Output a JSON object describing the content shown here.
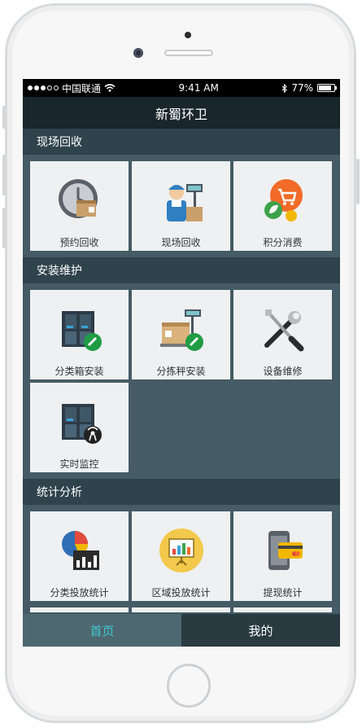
{
  "status_bar": {
    "carrier": "中国联通",
    "time": "9:41 AM",
    "battery": "77%"
  },
  "app": {
    "title": "新蜀环卫"
  },
  "sections": [
    {
      "title": "现场回收",
      "tiles": [
        {
          "label": "预约回收",
          "icon": "clock-box-icon"
        },
        {
          "label": "现场回收",
          "icon": "worker-icon"
        },
        {
          "label": "积分消费",
          "icon": "cart-icon"
        }
      ]
    },
    {
      "title": "安装维护",
      "tiles": [
        {
          "label": "分类箱安装",
          "icon": "bin-install-icon"
        },
        {
          "label": "分拣秤安装",
          "icon": "scale-install-icon"
        },
        {
          "label": "设备维修",
          "icon": "tools-icon"
        },
        {
          "label": "实时监控",
          "icon": "monitor-icon"
        }
      ]
    },
    {
      "title": "统计分析",
      "tiles": [
        {
          "label": "分类投放统计",
          "icon": "pie-chart-icon"
        },
        {
          "label": "区域投放统计",
          "icon": "presentation-icon"
        },
        {
          "label": "提现统计",
          "icon": "phone-card-icon"
        }
      ]
    }
  ],
  "tabs": [
    {
      "label": "首页",
      "active": true
    },
    {
      "label": "我的",
      "active": false
    }
  ],
  "colors": {
    "accent": "#40c8d0",
    "navbar": "#19262c",
    "panel": "#455b65",
    "tile": "#eef0f2"
  }
}
